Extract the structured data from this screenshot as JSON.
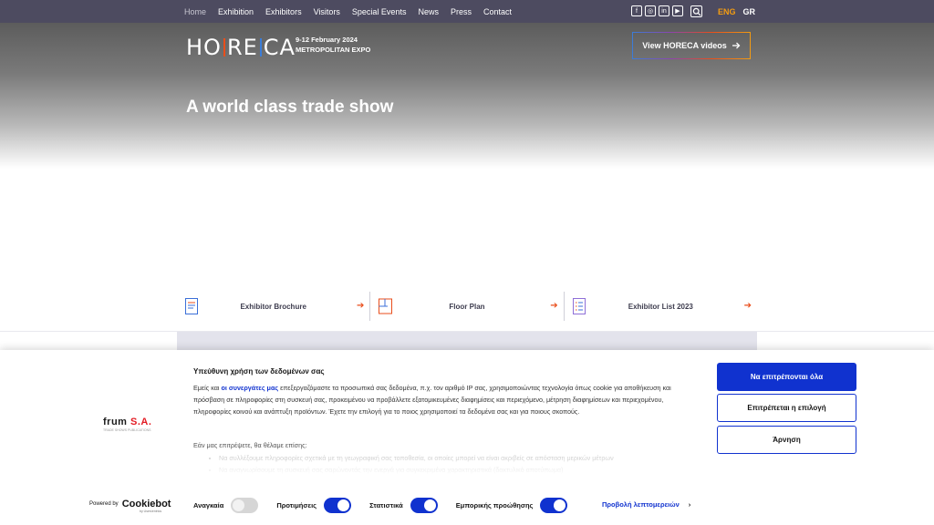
{
  "nav": {
    "items": [
      "Home",
      "Exhibition",
      "Exhibitors",
      "Visitors",
      "Special Events",
      "News",
      "Press",
      "Contact"
    ],
    "social": [
      "f",
      "◎",
      "in",
      "▶"
    ],
    "lang_eng": "ENG",
    "lang_gr": "GR"
  },
  "hero": {
    "logo_a": "HO",
    "logo_b": "RE",
    "logo_c": "CA",
    "dates": "9-12 February 2024",
    "venue": "METROPOLITAN EXPO",
    "video_button": "View HORECA videos",
    "tagline": "A world class trade show"
  },
  "quick_links": [
    {
      "label": "Exhibitor Brochure"
    },
    {
      "label": "Floor Plan"
    },
    {
      "label": "Exhibitor List 2023"
    }
  ],
  "cookie": {
    "brand_a": "f",
    "brand_b": "rum",
    "brand_c": "S.A.",
    "brand_sub": "TRADE SHOWS PUBLICATIONS",
    "title": "Υπεύθυνη χρήση των δεδομένων σας",
    "text_pre": "Εμείς και ",
    "text_link": "οι συνεργάτες μας",
    "text_post": " επεξεργαζόμαστε τα προσωπικά σας δεδομένα, π.χ. τον αριθμό IP σας, χρησιμοποιώντας τεχνολογία όπως cookie για αποθήκευση και πρόσβαση σε πληροφορίες στη συσκευή σας, προκειμένου να προβάλλετε εξατομικευμένες διαφημίσεις και περιεχόμενο, μέτρηση διαφημίσεων και περιεχομένου, πληροφορίες κοινού και ανάπτυξη προϊόντων. Έχετε την επιλογή για το ποιος χρησιμοποιεί τα δεδομένα σας και για ποιους σκοπούς.",
    "consent_intro": "Εάν μας επιτρέψετε, θα θέλαμε επίσης:",
    "faded_1": "Να συλλέξουμε πληροφορίες σχετικά με τη γεωγραφική σας τοποθεσία, οι οποίες μπορεί να είναι ακριβείς σε απόσταση μερικών μέτρων",
    "faded_2": "Να αναγνωρίσουμε τη συσκευή σας σαρώνοντάς την ενεργά για συγκεκριμένα χαρακτηριστικά (δακτυλικό αποτύπωμα)",
    "btn_allow_all": "Να επιτρέπονται όλα",
    "btn_allow_selection": "Επιτρέπεται η επιλογή",
    "btn_deny": "Άρνηση",
    "powered_by": "Powered by",
    "cookiebot": "Cookiebot",
    "usercentrics": "by Usercentrics",
    "toggles": [
      {
        "label": "Αναγκαία",
        "on": false
      },
      {
        "label": "Προτιμήσεις",
        "on": true
      },
      {
        "label": "Στατιστικά",
        "on": true
      },
      {
        "label": "Εμπορικής προώθησης",
        "on": true
      }
    ],
    "details_link": "Προβολή λεπτομερειών",
    "accent_color": "#1032cf"
  }
}
